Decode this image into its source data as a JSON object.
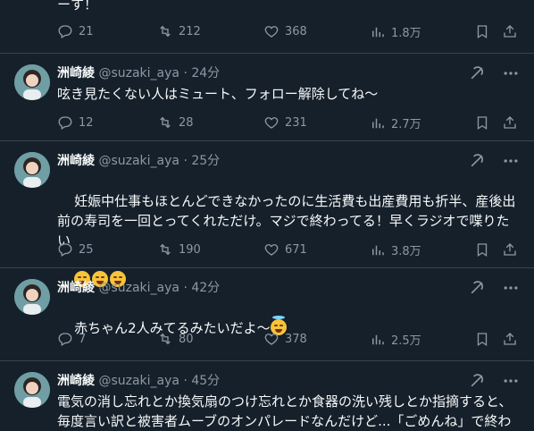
{
  "top_partial": {
    "text_fragment": "ーす！",
    "stats": {
      "replies": "21",
      "reposts": "212",
      "likes": "368",
      "views": "1.8万"
    }
  },
  "posts": [
    {
      "name": "洲崎綾",
      "handle": "@suzaki_aya",
      "dot": "·",
      "time": "24分",
      "text": "呟き見たくない人はミュート、フォロー解除してね〜",
      "stats": {
        "replies": "12",
        "reposts": "28",
        "likes": "231",
        "views": "2.7万"
      }
    },
    {
      "name": "洲崎綾",
      "handle": "@suzaki_aya",
      "dot": "·",
      "time": "25分",
      "text": "妊娠中仕事もほとんどできなかったのに生活費も出産費用も折半、産後出前の寿司を一回とってくれただけ。マジで終わってる！早くラジオで喋りたい",
      "stats": {
        "replies": "25",
        "reposts": "190",
        "likes": "671",
        "views": "3.8万"
      }
    },
    {
      "name": "洲崎綾",
      "handle": "@suzaki_aya",
      "dot": "·",
      "time": "42分",
      "text": "赤ちゃん2人みてるみたいだよ〜",
      "stats": {
        "replies": "7",
        "reposts": "80",
        "likes": "378",
        "views": "2.5万"
      }
    },
    {
      "name": "洲崎綾",
      "handle": "@suzaki_aya",
      "dot": "·",
      "time": "45分",
      "text": "電気の消し忘れとか換気扇のつけ忘れとか食器の洗い残しとか指摘すると、毎度言い訳と被害者ムーブのオンパレードなんだけど...「ごめんね」で終わ"
    }
  ],
  "colors": {
    "background": "#15202b",
    "text": "#f7f9f9",
    "muted": "#8b98a5",
    "divider": "#38444d"
  }
}
